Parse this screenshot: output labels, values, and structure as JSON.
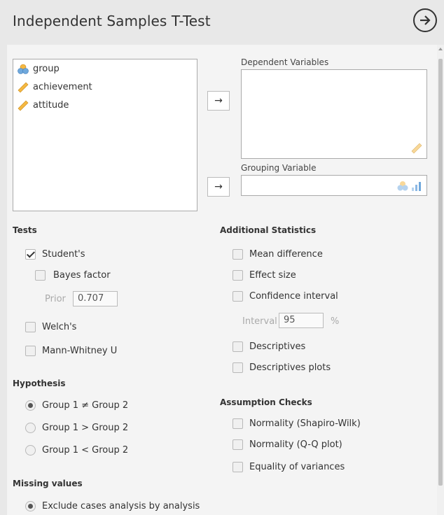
{
  "header": {
    "title": "Independent Samples T-Test",
    "run_icon": "arrow-circle-right-icon"
  },
  "variables": [
    {
      "name": "group",
      "icon": "nominal-icon"
    },
    {
      "name": "achievement",
      "icon": "continuous-ruler-icon"
    },
    {
      "name": "attitude",
      "icon": "continuous-ruler-icon"
    }
  ],
  "targets": {
    "dependent_label": "Dependent Variables",
    "grouping_label": "Grouping Variable",
    "arrow": "→"
  },
  "tests": {
    "title": "Tests",
    "students": "Student's",
    "bayes": "Bayes factor",
    "prior_label": "Prior",
    "prior_value": "0.707",
    "welch": "Welch's",
    "mann": "Mann-Whitney U"
  },
  "hypothesis": {
    "title": "Hypothesis",
    "opt1": "Group 1 ≠ Group 2",
    "opt2": "Group 1 > Group 2",
    "opt3": "Group 1 < Group 2"
  },
  "missing": {
    "title": "Missing values",
    "opt1": "Exclude cases analysis by analysis"
  },
  "additional": {
    "title": "Additional Statistics",
    "mean_diff": "Mean difference",
    "effect_size": "Effect size",
    "ci": "Confidence interval",
    "interval_label": "Interval",
    "interval_value": "95",
    "percent": "%",
    "descriptives": "Descriptives",
    "desc_plots": "Descriptives plots"
  },
  "assumptions": {
    "title": "Assumption Checks",
    "shapiro": "Normality (Shapiro-Wilk)",
    "qq": "Normality (Q-Q plot)",
    "equality": "Equality of variances"
  },
  "colors": {
    "accent": "#f5b841",
    "nominal_blue": "#6fa8dc",
    "background": "#e8e8e8"
  }
}
